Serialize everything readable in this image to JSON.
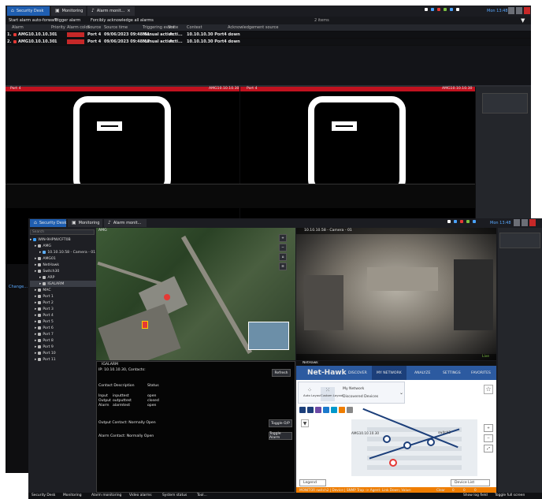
{
  "back_window": {
    "tabs": [
      {
        "label": "Security Desk",
        "active": true
      },
      {
        "label": "Monitoring",
        "active": false
      },
      {
        "label": "Alarm monit...",
        "active": false
      }
    ],
    "time": "Mon 13:48",
    "toolbar": {
      "start_auto_forward": "Start alarm auto-forward",
      "trigger_alarm": "Trigger alarm",
      "forcibly_ack": "Forcibly acknowledge all alarms",
      "item_count": "2 items"
    },
    "columns": [
      "Alarm",
      "Priority",
      "Alarm color",
      "Source",
      "Source time",
      "Triggering event",
      "State",
      "Context",
      "Acknowledgement source"
    ],
    "rows": [
      {
        "num": "1.",
        "alarm": "AMG10.10.10.30",
        "priority": "1",
        "source": "Port 4",
        "source_time": "09/06/2023 09:48:51",
        "event": "Manual action",
        "state": "Acti...",
        "context": "10.10.10.30 Port4 down"
      },
      {
        "num": "2.",
        "alarm": "AMG10.10.10.30",
        "priority": "1",
        "source": "Port 4",
        "source_time": "09/06/2023 09:48:17",
        "event": "Manual action",
        "state": "Acti...",
        "context": "10.10.10.30 Port4 down"
      }
    ],
    "tiles": [
      {
        "name": "Port 4",
        "ip": "AMG10.10.10.30"
      },
      {
        "name": "Port 4",
        "ip": "AMG10.10.10.30"
      }
    ],
    "footer": "Change..."
  },
  "front_window": {
    "tabs": [
      {
        "label": "Security Desk",
        "active": true
      },
      {
        "label": "Monitoring",
        "active": false
      },
      {
        "label": "Alarm monit...",
        "active": false
      }
    ],
    "time": "Mon 13:48",
    "search_placeholder": "Search",
    "tree": [
      {
        "label": "WIN-9HPNVCFT0B",
        "indent": 0,
        "color": "#3aa0ff"
      },
      {
        "label": "AMG",
        "indent": 1,
        "color": "#bbbbbb"
      },
      {
        "label": "10.10.10.58 - Camera - 01",
        "indent": 2,
        "color": "#5eb0ff"
      },
      {
        "label": "AMG01",
        "indent": 1,
        "color": "#bbbbbb"
      },
      {
        "label": "NetHawk",
        "indent": 1,
        "color": "#bbbbbb"
      },
      {
        "label": "Switch30",
        "indent": 1,
        "color": "#bbbbbb"
      },
      {
        "label": "ARP",
        "indent": 2,
        "color": "#bbbbbb"
      },
      {
        "label": "IGALARM",
        "indent": 2,
        "color": "#bbbbbb",
        "selected": true
      },
      {
        "label": "MAC",
        "indent": 1,
        "color": "#bbbbbb"
      },
      {
        "label": "Port 1",
        "indent": 1,
        "color": "#bbbbbb"
      },
      {
        "label": "Port 2",
        "indent": 1,
        "color": "#bbbbbb"
      },
      {
        "label": "Port 3",
        "indent": 1,
        "color": "#bbbbbb"
      },
      {
        "label": "Port 4",
        "indent": 1,
        "color": "#bbbbbb"
      },
      {
        "label": "Port 5",
        "indent": 1,
        "color": "#bbbbbb"
      },
      {
        "label": "Port 6",
        "indent": 1,
        "color": "#bbbbbb"
      },
      {
        "label": "Port 7",
        "indent": 1,
        "color": "#bbbbbb"
      },
      {
        "label": "Port 8",
        "indent": 1,
        "color": "#bbbbbb"
      },
      {
        "label": "Port 9",
        "indent": 1,
        "color": "#bbbbbb"
      },
      {
        "label": "Port 10",
        "indent": 1,
        "color": "#bbbbbb"
      },
      {
        "label": "Port 11",
        "indent": 1,
        "color": "#bbbbbb"
      }
    ],
    "map_tile": {
      "title": "AMG"
    },
    "camera_tile": {
      "title": "10.10.10.58 - Camera - 01",
      "status": "Live"
    },
    "contacts": {
      "title": "IGALARM",
      "subtitle": "IP: 10.10.10.30, Contacts:",
      "refresh": "Refresh",
      "col_desc": "Contact Description",
      "col_status": "Status",
      "rows": [
        {
          "name": "Input",
          "desc": "inputtest",
          "status": "open"
        },
        {
          "name": "Output",
          "desc": "outputtest",
          "status": "closed"
        },
        {
          "name": "Alarm",
          "desc": "alarmtest",
          "status": "open"
        }
      ],
      "output_label": "Output Contact: Normally Open",
      "toggle_output": "Toggle O/P",
      "alarm_label": "Alarm Contact: Normally Open",
      "toggle_alarm": "Toggle Alarm"
    },
    "nethawk": {
      "tile_title": "NetHawk",
      "brand": "Net-Hawk",
      "nav": [
        "DISCOVER",
        "MY NETWORK",
        "ANALYZE",
        "SETTINGS",
        "FAVORITES"
      ],
      "active_nav": "MY NETWORK",
      "layout_auto": "Auto Layout",
      "layout_custom": "Custom Layout",
      "my_network": "My Network",
      "discovered": "Discovered Devices",
      "node_label": "AMG10.10.10.30",
      "switch_label": "switch2",
      "legend": "Legend",
      "device_list": "Device List",
      "status_bar": "MONITOR  switch2 | Device | SNMP Trap -> Agent: Link Down; Value:",
      "status_link": "Clear",
      "counts": [
        "0",
        "0",
        "0"
      ]
    },
    "taskbar": [
      "Security Desk",
      "Monitoring",
      "Alarm monitoring",
      "Video alarms",
      "System status",
      "Tool..."
    ],
    "taskbar_right": [
      "Show log field",
      "Toggle full screen"
    ]
  }
}
